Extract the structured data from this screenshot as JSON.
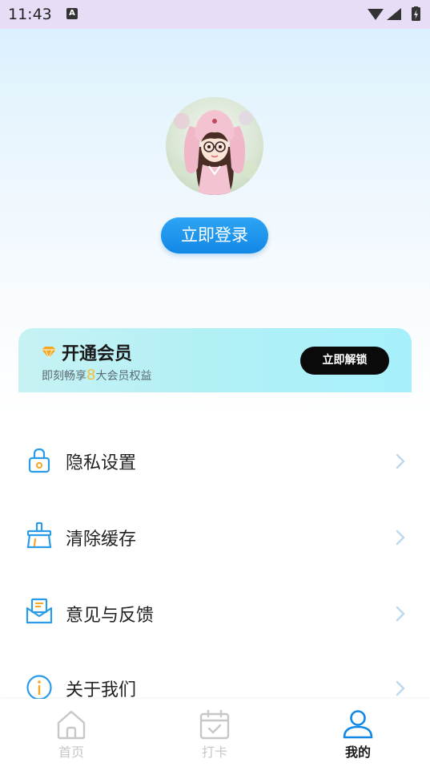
{
  "status_bar": {
    "time": "11:43",
    "notification_badge": "A"
  },
  "profile": {
    "avatar_icon": "girl-avatar-icon",
    "login_button": "立即登录"
  },
  "vip_card": {
    "title": "开通会员",
    "subtitle_prefix": "即刻畅享",
    "subtitle_number": "8",
    "subtitle_suffix": "大会员权益",
    "unlock_button": "立即解锁",
    "diamond_icon": "diamond-icon"
  },
  "menu": {
    "items": [
      {
        "label": "隐私设置",
        "icon": "lock-icon"
      },
      {
        "label": "清除缓存",
        "icon": "broom-icon"
      },
      {
        "label": "意见与反馈",
        "icon": "mail-icon"
      },
      {
        "label": "关于我们",
        "icon": "info-icon"
      }
    ]
  },
  "tab_bar": {
    "tabs": [
      {
        "label": "首页",
        "icon": "home-icon",
        "active": false
      },
      {
        "label": "打卡",
        "icon": "calendar-check-icon",
        "active": false
      },
      {
        "label": "我的",
        "icon": "user-icon",
        "active": true
      }
    ]
  },
  "colors": {
    "accent": "#1288e6",
    "inactive_tab": "#c7c7c7",
    "icon_blue": "#2a9be8"
  }
}
